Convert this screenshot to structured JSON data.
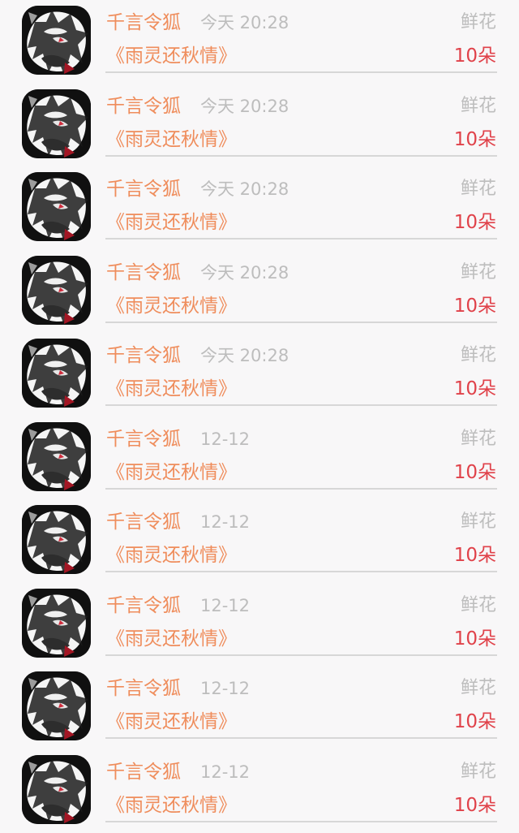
{
  "rows": [
    {
      "user": "千言令狐",
      "time": "今天 20:28",
      "gift": "鲜花",
      "book": "《雨灵还秋情》",
      "amount": "10朵"
    },
    {
      "user": "千言令狐",
      "time": "今天 20:28",
      "gift": "鲜花",
      "book": "《雨灵还秋情》",
      "amount": "10朵"
    },
    {
      "user": "千言令狐",
      "time": "今天 20:28",
      "gift": "鲜花",
      "book": "《雨灵还秋情》",
      "amount": "10朵"
    },
    {
      "user": "千言令狐",
      "time": "今天 20:28",
      "gift": "鲜花",
      "book": "《雨灵还秋情》",
      "amount": "10朵"
    },
    {
      "user": "千言令狐",
      "time": "今天 20:28",
      "gift": "鲜花",
      "book": "《雨灵还秋情》",
      "amount": "10朵"
    },
    {
      "user": "千言令狐",
      "time": "12-12",
      "gift": "鲜花",
      "book": "《雨灵还秋情》",
      "amount": "10朵"
    },
    {
      "user": "千言令狐",
      "time": "12-12",
      "gift": "鲜花",
      "book": "《雨灵还秋情》",
      "amount": "10朵"
    },
    {
      "user": "千言令狐",
      "time": "12-12",
      "gift": "鲜花",
      "book": "《雨灵还秋情》",
      "amount": "10朵"
    },
    {
      "user": "千言令狐",
      "time": "12-12",
      "gift": "鲜花",
      "book": "《雨灵还秋情》",
      "amount": "10朵"
    },
    {
      "user": "千言令狐",
      "time": "12-12",
      "gift": "鲜花",
      "book": "《雨灵还秋情》",
      "amount": "10朵"
    }
  ],
  "colors": {
    "background": "#f8f7f8",
    "name": "#ef8d5c",
    "time": "#bdbdbd",
    "gift": "#bdbdbd",
    "count": "#e0424a",
    "divider": "#d7d7d7"
  }
}
